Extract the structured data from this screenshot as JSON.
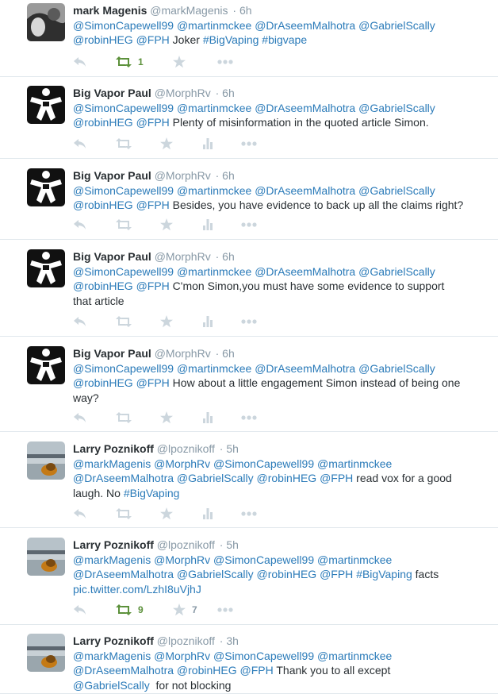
{
  "colors": {
    "link": "#2b7bb9",
    "muted": "#8899a6",
    "action_icon": "#ccd6dd",
    "retweet_active": "#5c913b",
    "divider": "#e1e8ed"
  },
  "tweets": [
    {
      "fullname": "mark Magenis",
      "username": "@markMagenis",
      "time": "· 6h",
      "avatar": "photo-avatar-dark",
      "segments": [
        {
          "t": "@SimonCapewell99",
          "k": "mention"
        },
        {
          "t": " ",
          "k": "text"
        },
        {
          "t": "@martinmckee",
          "k": "mention"
        },
        {
          "t": " ",
          "k": "text"
        },
        {
          "t": "@DrAseemMalhotra",
          "k": "mention"
        },
        {
          "t": " ",
          "k": "text"
        },
        {
          "t": "@GabrielScally",
          "k": "mention"
        },
        {
          "t": "\n",
          "k": "text"
        },
        {
          "t": "@robinHEG",
          "k": "mention"
        },
        {
          "t": " ",
          "k": "text"
        },
        {
          "t": "@FPH",
          "k": "mention"
        },
        {
          "t": " Joker ",
          "k": "text"
        },
        {
          "t": "#BigVaping",
          "k": "tag"
        },
        {
          "t": " ",
          "k": "text"
        },
        {
          "t": "#bigvape",
          "k": "tag"
        }
      ],
      "retweets": "1",
      "favorites": "",
      "retweeted": true,
      "analytics": false
    },
    {
      "fullname": "Big Vapor Paul",
      "username": "@MorphRv",
      "time": "· 6h",
      "avatar": "vape-logo-avatar",
      "segments": [
        {
          "t": "@SimonCapewell99",
          "k": "mention"
        },
        {
          "t": " ",
          "k": "text"
        },
        {
          "t": "@martinmckee",
          "k": "mention"
        },
        {
          "t": " ",
          "k": "text"
        },
        {
          "t": "@DrAseemMalhotra",
          "k": "mention"
        },
        {
          "t": " ",
          "k": "text"
        },
        {
          "t": "@GabrielScally",
          "k": "mention"
        },
        {
          "t": "\n",
          "k": "text"
        },
        {
          "t": "@robinHEG",
          "k": "mention"
        },
        {
          "t": " ",
          "k": "text"
        },
        {
          "t": "@FPH",
          "k": "mention"
        },
        {
          "t": " Plenty of misinformation in the quoted article Simon.",
          "k": "text"
        }
      ],
      "retweets": "",
      "favorites": "",
      "retweeted": false,
      "analytics": true
    },
    {
      "fullname": "Big Vapor Paul",
      "username": "@MorphRv",
      "time": "· 6h",
      "avatar": "vape-logo-avatar",
      "segments": [
        {
          "t": "@SimonCapewell99",
          "k": "mention"
        },
        {
          "t": " ",
          "k": "text"
        },
        {
          "t": "@martinmckee",
          "k": "mention"
        },
        {
          "t": " ",
          "k": "text"
        },
        {
          "t": "@DrAseemMalhotra",
          "k": "mention"
        },
        {
          "t": " ",
          "k": "text"
        },
        {
          "t": "@GabrielScally",
          "k": "mention"
        },
        {
          "t": "\n",
          "k": "text"
        },
        {
          "t": "@robinHEG",
          "k": "mention"
        },
        {
          "t": " ",
          "k": "text"
        },
        {
          "t": "@FPH",
          "k": "mention"
        },
        {
          "t": " Besides, you have evidence to back up all the claims right?",
          "k": "text"
        }
      ],
      "retweets": "",
      "favorites": "",
      "retweeted": false,
      "analytics": true
    },
    {
      "fullname": "Big Vapor Paul",
      "username": "@MorphRv",
      "time": "· 6h",
      "avatar": "vape-logo-avatar",
      "segments": [
        {
          "t": "@SimonCapewell99",
          "k": "mention"
        },
        {
          "t": " ",
          "k": "text"
        },
        {
          "t": "@martinmckee",
          "k": "mention"
        },
        {
          "t": " ",
          "k": "text"
        },
        {
          "t": "@DrAseemMalhotra",
          "k": "mention"
        },
        {
          "t": " ",
          "k": "text"
        },
        {
          "t": "@GabrielScally",
          "k": "mention"
        },
        {
          "t": "\n",
          "k": "text"
        },
        {
          "t": "@robinHEG",
          "k": "mention"
        },
        {
          "t": " ",
          "k": "text"
        },
        {
          "t": "@FPH",
          "k": "mention"
        },
        {
          "t": " C'mon Simon,you must have some evidence to support\nthat article",
          "k": "text"
        }
      ],
      "retweets": "",
      "favorites": "",
      "retweeted": false,
      "analytics": true
    },
    {
      "fullname": "Big Vapor Paul",
      "username": "@MorphRv",
      "time": "· 6h",
      "avatar": "vape-logo-avatar",
      "segments": [
        {
          "t": "@SimonCapewell99",
          "k": "mention"
        },
        {
          "t": " ",
          "k": "text"
        },
        {
          "t": "@martinmckee",
          "k": "mention"
        },
        {
          "t": " ",
          "k": "text"
        },
        {
          "t": "@DrAseemMalhotra",
          "k": "mention"
        },
        {
          "t": " ",
          "k": "text"
        },
        {
          "t": "@GabrielScally",
          "k": "mention"
        },
        {
          "t": "\n",
          "k": "text"
        },
        {
          "t": "@robinHEG",
          "k": "mention"
        },
        {
          "t": " ",
          "k": "text"
        },
        {
          "t": "@FPH",
          "k": "mention"
        },
        {
          "t": " How about a little engagement Simon instead of being one\nway?",
          "k": "text"
        }
      ],
      "retweets": "",
      "favorites": "",
      "retweeted": false,
      "analytics": true
    },
    {
      "fullname": "Larry Poznikoff",
      "username": "@lpoznikoff",
      "time": "· 5h",
      "avatar": "lake-photo-avatar",
      "segments": [
        {
          "t": "@markMagenis",
          "k": "mention"
        },
        {
          "t": " ",
          "k": "text"
        },
        {
          "t": "@MorphRv",
          "k": "mention"
        },
        {
          "t": " ",
          "k": "text"
        },
        {
          "t": "@SimonCapewell99",
          "k": "mention"
        },
        {
          "t": " ",
          "k": "text"
        },
        {
          "t": "@martinmckee",
          "k": "mention"
        },
        {
          "t": "\n",
          "k": "text"
        },
        {
          "t": "@DrAseemMalhotra",
          "k": "mention"
        },
        {
          "t": " ",
          "k": "text"
        },
        {
          "t": "@GabrielScally",
          "k": "mention"
        },
        {
          "t": " ",
          "k": "text"
        },
        {
          "t": "@robinHEG",
          "k": "mention"
        },
        {
          "t": " ",
          "k": "text"
        },
        {
          "t": "@FPH",
          "k": "mention"
        },
        {
          "t": " read vox for a good\nlaugh. No ",
          "k": "text"
        },
        {
          "t": "#BigVaping",
          "k": "tag"
        }
      ],
      "retweets": "",
      "favorites": "",
      "retweeted": false,
      "analytics": true
    },
    {
      "fullname": "Larry Poznikoff",
      "username": "@lpoznikoff",
      "time": "· 5h",
      "avatar": "lake-photo-avatar",
      "segments": [
        {
          "t": "@markMagenis",
          "k": "mention"
        },
        {
          "t": " ",
          "k": "text"
        },
        {
          "t": "@MorphRv",
          "k": "mention"
        },
        {
          "t": " ",
          "k": "text"
        },
        {
          "t": "@SimonCapewell99",
          "k": "mention"
        },
        {
          "t": " ",
          "k": "text"
        },
        {
          "t": "@martinmckee",
          "k": "mention"
        },
        {
          "t": "\n",
          "k": "text"
        },
        {
          "t": "@DrAseemMalhotra",
          "k": "mention"
        },
        {
          "t": " ",
          "k": "text"
        },
        {
          "t": "@GabrielScally",
          "k": "mention"
        },
        {
          "t": " ",
          "k": "text"
        },
        {
          "t": "@robinHEG",
          "k": "mention"
        },
        {
          "t": " ",
          "k": "text"
        },
        {
          "t": "@FPH",
          "k": "mention"
        },
        {
          "t": " ",
          "k": "text"
        },
        {
          "t": "#BigVaping",
          "k": "tag"
        },
        {
          "t": " facts\n",
          "k": "text"
        },
        {
          "t": "pic.twitter.com/LzhI8uVjhJ",
          "k": "link"
        }
      ],
      "retweets": "9",
      "favorites": "7",
      "retweeted": true,
      "analytics": false
    },
    {
      "fullname": "Larry Poznikoff",
      "username": "@lpoznikoff",
      "time": "· 3h",
      "avatar": "lake-photo-avatar",
      "segments": [
        {
          "t": "@markMagenis",
          "k": "mention"
        },
        {
          "t": " ",
          "k": "text"
        },
        {
          "t": "@MorphRv",
          "k": "mention"
        },
        {
          "t": " ",
          "k": "text"
        },
        {
          "t": "@SimonCapewell99",
          "k": "mention"
        },
        {
          "t": " ",
          "k": "text"
        },
        {
          "t": "@martinmckee",
          "k": "mention"
        },
        {
          "t": "\n",
          "k": "text"
        },
        {
          "t": "@DrAseemMalhotra",
          "k": "mention"
        },
        {
          "t": " ",
          "k": "text"
        },
        {
          "t": "@robinHEG",
          "k": "mention"
        },
        {
          "t": " ",
          "k": "text"
        },
        {
          "t": "@FPH",
          "k": "mention"
        },
        {
          "t": " Thank you to all except\n",
          "k": "text"
        },
        {
          "t": "@GabrielScally",
          "k": "mention"
        },
        {
          "t": "  for not blocking",
          "k": "text"
        }
      ],
      "retweets": "",
      "favorites": "",
      "retweeted": false,
      "analytics": false
    }
  ]
}
